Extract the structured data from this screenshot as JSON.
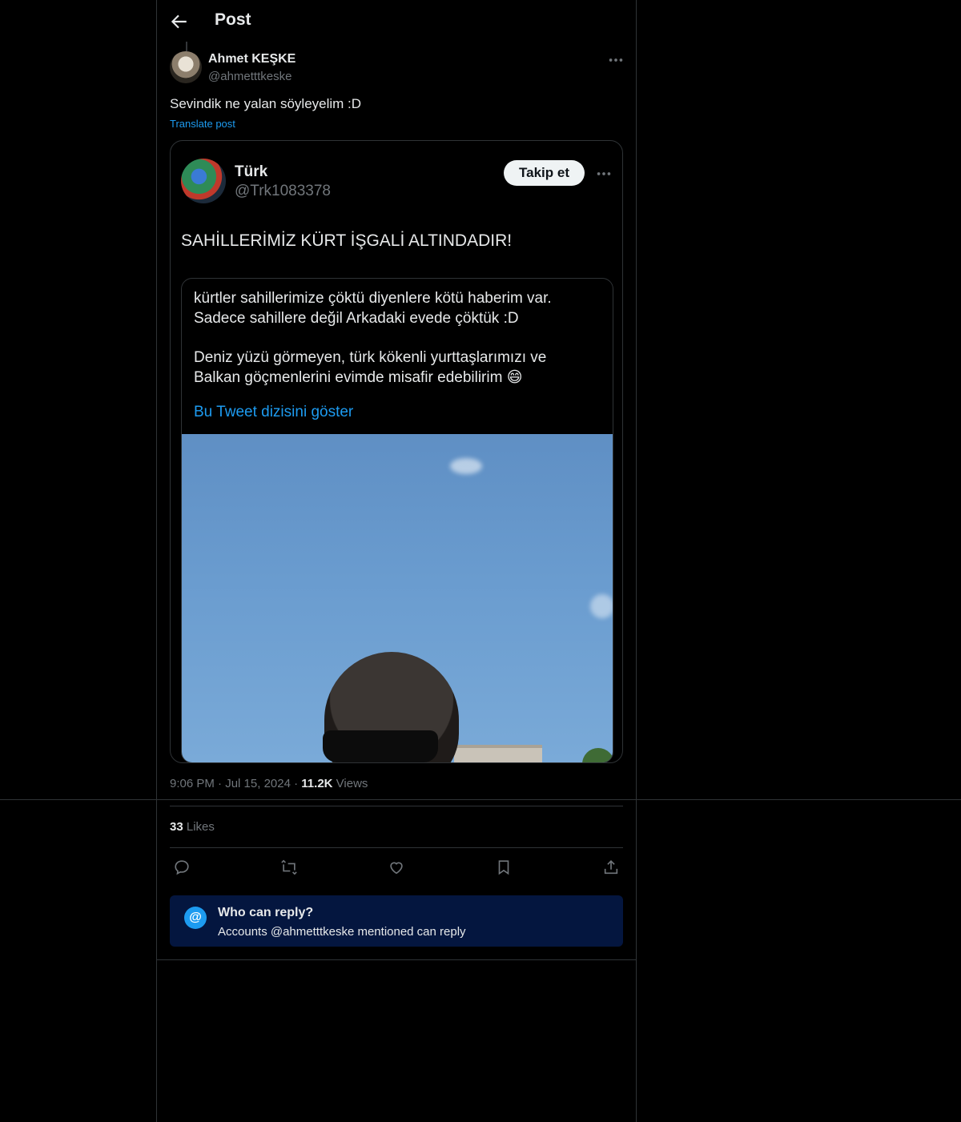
{
  "header": {
    "title": "Post",
    "back_icon": "arrow-left-icon"
  },
  "post": {
    "author": {
      "name": "Ahmet KEŞKE",
      "handle": "@ahmetttkeske"
    },
    "text": "Sevindik ne yalan söyleyelim :D",
    "translate_label": "Translate post",
    "time": "9:06 PM",
    "date": "Jul 15, 2024",
    "views_count": "11.2K",
    "views_label": "Views",
    "likes_count": "33",
    "likes_label": "Likes"
  },
  "screenshot": {
    "name": "Türk",
    "handle": "@Trk1083378",
    "follow_label": "Takip et",
    "headline": "SAHİLLERİMİZ KÜRT İŞGALİ ALTINDADIR!",
    "quote": {
      "line1": "kürtler sahillerimize çöktü diyenlere kötü haberim var.",
      "line2": "Sadece sahillere değil Arkadaki evede çöktük :D",
      "line3": "Deniz yüzü görmeyen, türk kökenli yurttaşlarımızı ve",
      "line4": "Balkan göçmenlerini evimde misafir edebilirim 😄",
      "link": "Bu Tweet dizisini göster"
    }
  },
  "actions": [
    "reply-icon",
    "repost-icon",
    "like-icon",
    "bookmark-icon",
    "share-icon"
  ],
  "reply_notice": {
    "title": "Who can reply?",
    "subtitle": "Accounts @ahmetttkeske mentioned can reply"
  },
  "colors": {
    "accent": "#1d9bf0",
    "notice_bg": "#04163f",
    "muted": "#71767b"
  }
}
